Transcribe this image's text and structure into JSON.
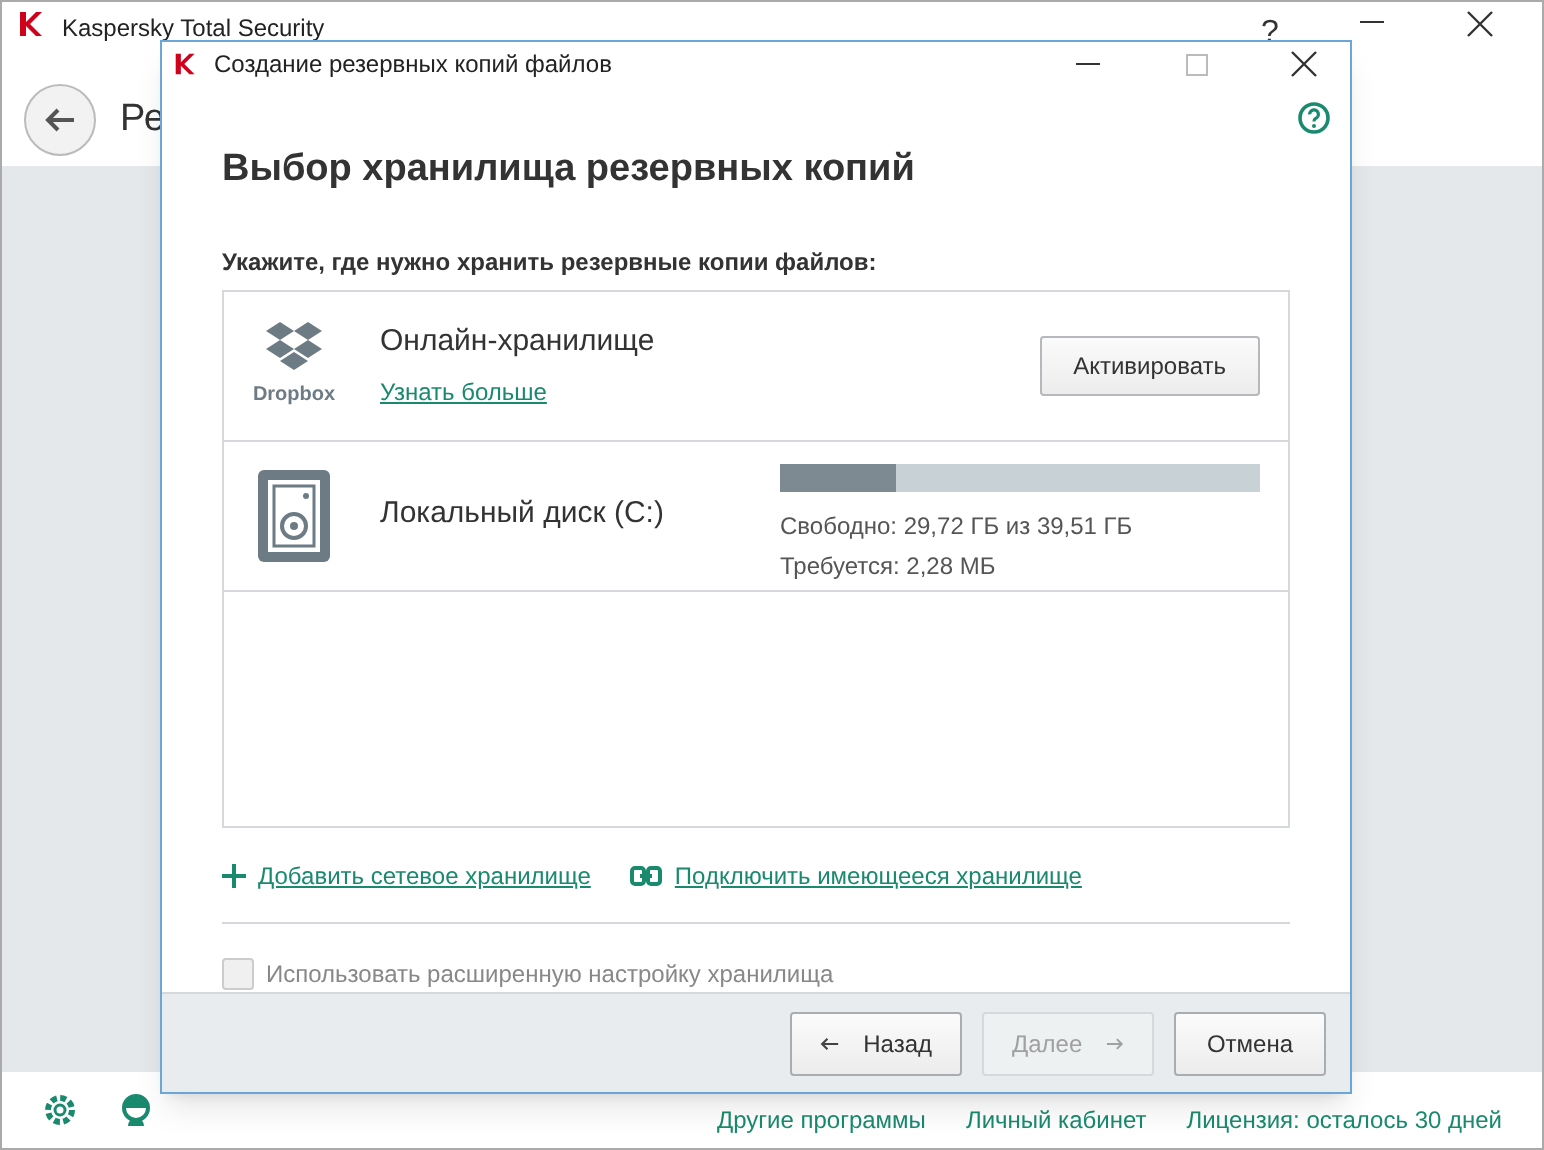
{
  "main_window": {
    "title": "Kaspersky Total Security",
    "help": "?",
    "heading": "Ре",
    "footer_links": [
      "Другие программы",
      "Личный кабинет",
      "Лицензия: осталось 30 дней"
    ]
  },
  "dialog": {
    "title": "Создание резервных копий файлов",
    "heading": "Выбор хранилища резервных копий",
    "prompt": "Укажите, где нужно хранить резервные копии файлов:",
    "storages": [
      {
        "kind": "online",
        "logo_text": "Dropbox",
        "name": "Онлайн-хранилище",
        "link": "Узнать больше",
        "button": "Активировать"
      },
      {
        "kind": "local",
        "name": "Локальный диск (C:)",
        "level": 0.24,
        "free": "Свободно: 29,72 ГБ из 39,51 ГБ",
        "required": "Требуется: 2,28 МБ"
      }
    ],
    "links": [
      {
        "kind": "add",
        "label": "Добавить сетевое хранилище"
      },
      {
        "kind": "connect",
        "label": "Подключить имеющееся хранилище"
      }
    ],
    "advanced": {
      "label": "Использовать расширенную настройку хранилища",
      "checked": false,
      "disabled": true
    },
    "buttons": [
      {
        "kind": "back",
        "label": "Назад",
        "disabled": false
      },
      {
        "kind": "next",
        "label": "Далее",
        "disabled": true
      },
      {
        "kind": "cancel",
        "label": "Отмена",
        "disabled": false
      }
    ]
  }
}
